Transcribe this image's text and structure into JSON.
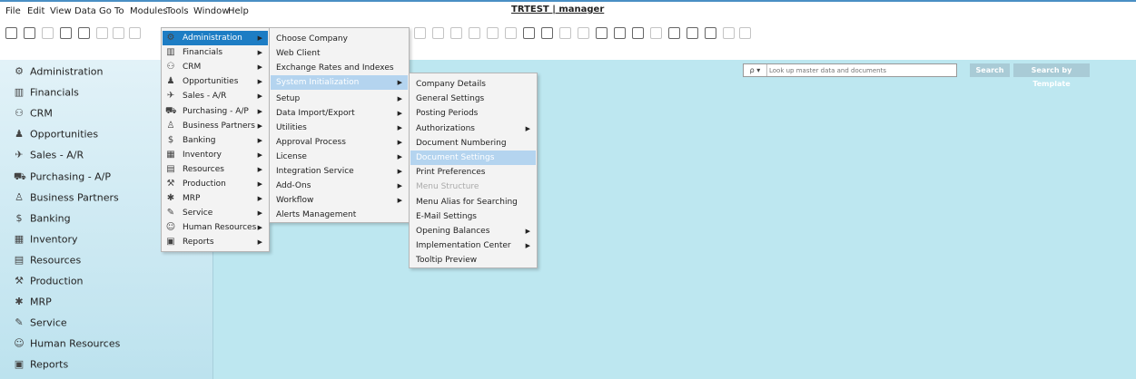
{
  "menubar": {
    "items": [
      "File",
      "Edit",
      "View",
      "Data",
      "Go To",
      "Modules",
      "Tools",
      "Window",
      "Help"
    ],
    "title": "TRTEST | manager"
  },
  "search": {
    "dropdown_label": "ρ ▾",
    "placeholder": "Look up master data and documents",
    "search_label": "Search",
    "template_label": "Search by Template"
  },
  "sidebar": {
    "items": [
      {
        "label": "Administration",
        "icon": "administration-icon",
        "glyph": "⚙"
      },
      {
        "label": "Financials",
        "icon": "financials-icon",
        "glyph": "▥"
      },
      {
        "label": "CRM",
        "icon": "crm-icon",
        "glyph": "⚇"
      },
      {
        "label": "Opportunities",
        "icon": "opportunities-icon",
        "glyph": "♟"
      },
      {
        "label": "Sales - A/R",
        "icon": "sales-icon",
        "glyph": "✈"
      },
      {
        "label": "Purchasing - A/P",
        "icon": "purchasing-icon",
        "glyph": "⛟"
      },
      {
        "label": "Business Partners",
        "icon": "business-partners-icon",
        "glyph": "♙"
      },
      {
        "label": "Banking",
        "icon": "banking-icon",
        "glyph": "$"
      },
      {
        "label": "Inventory",
        "icon": "inventory-icon",
        "glyph": "▦"
      },
      {
        "label": "Resources",
        "icon": "resources-icon",
        "glyph": "▤"
      },
      {
        "label": "Production",
        "icon": "production-icon",
        "glyph": "⚒"
      },
      {
        "label": "MRP",
        "icon": "mrp-icon",
        "glyph": "✱"
      },
      {
        "label": "Service",
        "icon": "service-icon",
        "glyph": "✎"
      },
      {
        "label": "Human Resources",
        "icon": "human-resources-icon",
        "glyph": "☺"
      },
      {
        "label": "Reports",
        "icon": "reports-icon",
        "glyph": "▣"
      }
    ]
  },
  "modules_menu": {
    "items": [
      {
        "label": "Administration",
        "icon": "administration-icon",
        "glyph": "⚙"
      },
      {
        "label": "Financials",
        "icon": "financials-icon",
        "glyph": "▥"
      },
      {
        "label": "CRM",
        "icon": "crm-icon",
        "glyph": "⚇"
      },
      {
        "label": "Opportunities",
        "icon": "opportunities-icon",
        "glyph": "♟"
      },
      {
        "label": "Sales - A/R",
        "icon": "sales-icon",
        "glyph": "✈"
      },
      {
        "label": "Purchasing - A/P",
        "icon": "purchasing-icon",
        "glyph": "⛟"
      },
      {
        "label": "Business Partners",
        "icon": "business-partners-icon",
        "glyph": "♙"
      },
      {
        "label": "Banking",
        "icon": "banking-icon",
        "glyph": "$"
      },
      {
        "label": "Inventory",
        "icon": "inventory-icon",
        "glyph": "▦"
      },
      {
        "label": "Resources",
        "icon": "resources-icon",
        "glyph": "▤"
      },
      {
        "label": "Production",
        "icon": "production-icon",
        "glyph": "⚒"
      },
      {
        "label": "MRP",
        "icon": "mrp-icon",
        "glyph": "✱"
      },
      {
        "label": "Service",
        "icon": "service-icon",
        "glyph": "✎"
      },
      {
        "label": "Human Resources",
        "icon": "human-resources-icon",
        "glyph": "☺"
      },
      {
        "label": "Reports",
        "icon": "reports-icon",
        "glyph": "▣"
      }
    ]
  },
  "administration_menu": {
    "items": [
      "Choose Company",
      "Web Client",
      "Exchange Rates and Indexes",
      "System Initialization",
      "Setup",
      "Data Import/Export",
      "Utilities",
      "Approval Process",
      "License",
      "Integration Service",
      "Add-Ons",
      "Workflow",
      "Alerts Management"
    ]
  },
  "system_init_menu": {
    "items": [
      "Company Details",
      "General Settings",
      "Posting Periods",
      "Authorizations",
      "Document Numbering",
      "Document Settings",
      "Print Preferences",
      "Menu Structure",
      "Menu Alias for Searching",
      "E-Mail Settings",
      "Opening Balances",
      "Implementation Center",
      "Tooltip Preview"
    ]
  },
  "colors": {
    "highlight": "#1d7dc4",
    "hover": "#b4d4ef",
    "main_bg": "#bde7f0",
    "button": "#a9cbd6"
  }
}
